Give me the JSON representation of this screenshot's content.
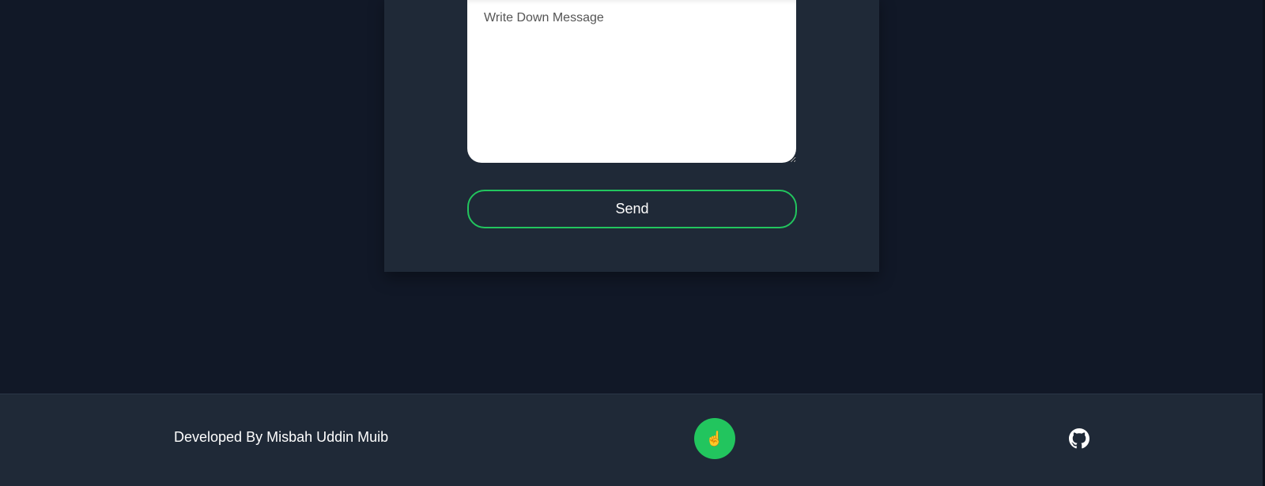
{
  "contact_form": {
    "message_placeholder": "Write Down Message",
    "send_label": "Send"
  },
  "footer": {
    "credit_text": "Developed By Misbah Uddin Muib",
    "top_button_icon": "☝",
    "github_icon": "github-icon"
  },
  "colors": {
    "background": "#111827",
    "card": "#1f2937",
    "accent": "#22c55e"
  }
}
